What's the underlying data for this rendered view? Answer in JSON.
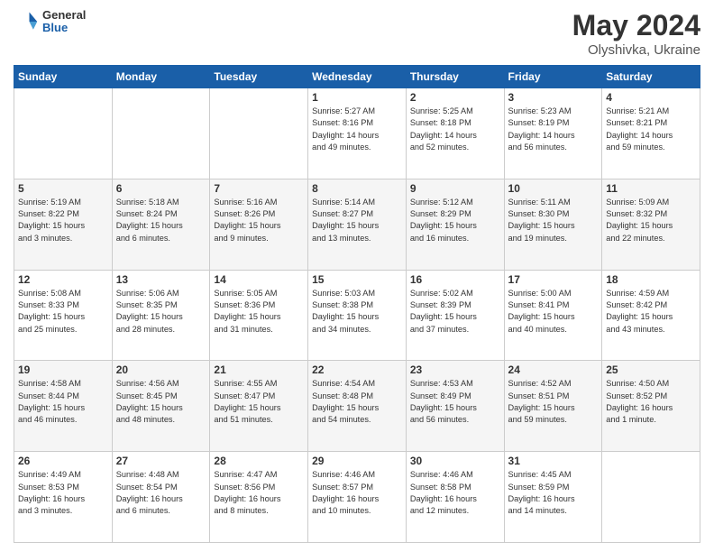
{
  "header": {
    "logo": {
      "general": "General",
      "blue": "Blue"
    },
    "title": "May 2024",
    "location": "Olyshivka, Ukraine"
  },
  "weekdays": [
    "Sunday",
    "Monday",
    "Tuesday",
    "Wednesday",
    "Thursday",
    "Friday",
    "Saturday"
  ],
  "weeks": [
    [
      {
        "day": "",
        "info": ""
      },
      {
        "day": "",
        "info": ""
      },
      {
        "day": "",
        "info": ""
      },
      {
        "day": "1",
        "info": "Sunrise: 5:27 AM\nSunset: 8:16 PM\nDaylight: 14 hours\nand 49 minutes."
      },
      {
        "day": "2",
        "info": "Sunrise: 5:25 AM\nSunset: 8:18 PM\nDaylight: 14 hours\nand 52 minutes."
      },
      {
        "day": "3",
        "info": "Sunrise: 5:23 AM\nSunset: 8:19 PM\nDaylight: 14 hours\nand 56 minutes."
      },
      {
        "day": "4",
        "info": "Sunrise: 5:21 AM\nSunset: 8:21 PM\nDaylight: 14 hours\nand 59 minutes."
      }
    ],
    [
      {
        "day": "5",
        "info": "Sunrise: 5:19 AM\nSunset: 8:22 PM\nDaylight: 15 hours\nand 3 minutes."
      },
      {
        "day": "6",
        "info": "Sunrise: 5:18 AM\nSunset: 8:24 PM\nDaylight: 15 hours\nand 6 minutes."
      },
      {
        "day": "7",
        "info": "Sunrise: 5:16 AM\nSunset: 8:26 PM\nDaylight: 15 hours\nand 9 minutes."
      },
      {
        "day": "8",
        "info": "Sunrise: 5:14 AM\nSunset: 8:27 PM\nDaylight: 15 hours\nand 13 minutes."
      },
      {
        "day": "9",
        "info": "Sunrise: 5:12 AM\nSunset: 8:29 PM\nDaylight: 15 hours\nand 16 minutes."
      },
      {
        "day": "10",
        "info": "Sunrise: 5:11 AM\nSunset: 8:30 PM\nDaylight: 15 hours\nand 19 minutes."
      },
      {
        "day": "11",
        "info": "Sunrise: 5:09 AM\nSunset: 8:32 PM\nDaylight: 15 hours\nand 22 minutes."
      }
    ],
    [
      {
        "day": "12",
        "info": "Sunrise: 5:08 AM\nSunset: 8:33 PM\nDaylight: 15 hours\nand 25 minutes."
      },
      {
        "day": "13",
        "info": "Sunrise: 5:06 AM\nSunset: 8:35 PM\nDaylight: 15 hours\nand 28 minutes."
      },
      {
        "day": "14",
        "info": "Sunrise: 5:05 AM\nSunset: 8:36 PM\nDaylight: 15 hours\nand 31 minutes."
      },
      {
        "day": "15",
        "info": "Sunrise: 5:03 AM\nSunset: 8:38 PM\nDaylight: 15 hours\nand 34 minutes."
      },
      {
        "day": "16",
        "info": "Sunrise: 5:02 AM\nSunset: 8:39 PM\nDaylight: 15 hours\nand 37 minutes."
      },
      {
        "day": "17",
        "info": "Sunrise: 5:00 AM\nSunset: 8:41 PM\nDaylight: 15 hours\nand 40 minutes."
      },
      {
        "day": "18",
        "info": "Sunrise: 4:59 AM\nSunset: 8:42 PM\nDaylight: 15 hours\nand 43 minutes."
      }
    ],
    [
      {
        "day": "19",
        "info": "Sunrise: 4:58 AM\nSunset: 8:44 PM\nDaylight: 15 hours\nand 46 minutes."
      },
      {
        "day": "20",
        "info": "Sunrise: 4:56 AM\nSunset: 8:45 PM\nDaylight: 15 hours\nand 48 minutes."
      },
      {
        "day": "21",
        "info": "Sunrise: 4:55 AM\nSunset: 8:47 PM\nDaylight: 15 hours\nand 51 minutes."
      },
      {
        "day": "22",
        "info": "Sunrise: 4:54 AM\nSunset: 8:48 PM\nDaylight: 15 hours\nand 54 minutes."
      },
      {
        "day": "23",
        "info": "Sunrise: 4:53 AM\nSunset: 8:49 PM\nDaylight: 15 hours\nand 56 minutes."
      },
      {
        "day": "24",
        "info": "Sunrise: 4:52 AM\nSunset: 8:51 PM\nDaylight: 15 hours\nand 59 minutes."
      },
      {
        "day": "25",
        "info": "Sunrise: 4:50 AM\nSunset: 8:52 PM\nDaylight: 16 hours\nand 1 minute."
      }
    ],
    [
      {
        "day": "26",
        "info": "Sunrise: 4:49 AM\nSunset: 8:53 PM\nDaylight: 16 hours\nand 3 minutes."
      },
      {
        "day": "27",
        "info": "Sunrise: 4:48 AM\nSunset: 8:54 PM\nDaylight: 16 hours\nand 6 minutes."
      },
      {
        "day": "28",
        "info": "Sunrise: 4:47 AM\nSunset: 8:56 PM\nDaylight: 16 hours\nand 8 minutes."
      },
      {
        "day": "29",
        "info": "Sunrise: 4:46 AM\nSunset: 8:57 PM\nDaylight: 16 hours\nand 10 minutes."
      },
      {
        "day": "30",
        "info": "Sunrise: 4:46 AM\nSunset: 8:58 PM\nDaylight: 16 hours\nand 12 minutes."
      },
      {
        "day": "31",
        "info": "Sunrise: 4:45 AM\nSunset: 8:59 PM\nDaylight: 16 hours\nand 14 minutes."
      },
      {
        "day": "",
        "info": ""
      }
    ]
  ]
}
